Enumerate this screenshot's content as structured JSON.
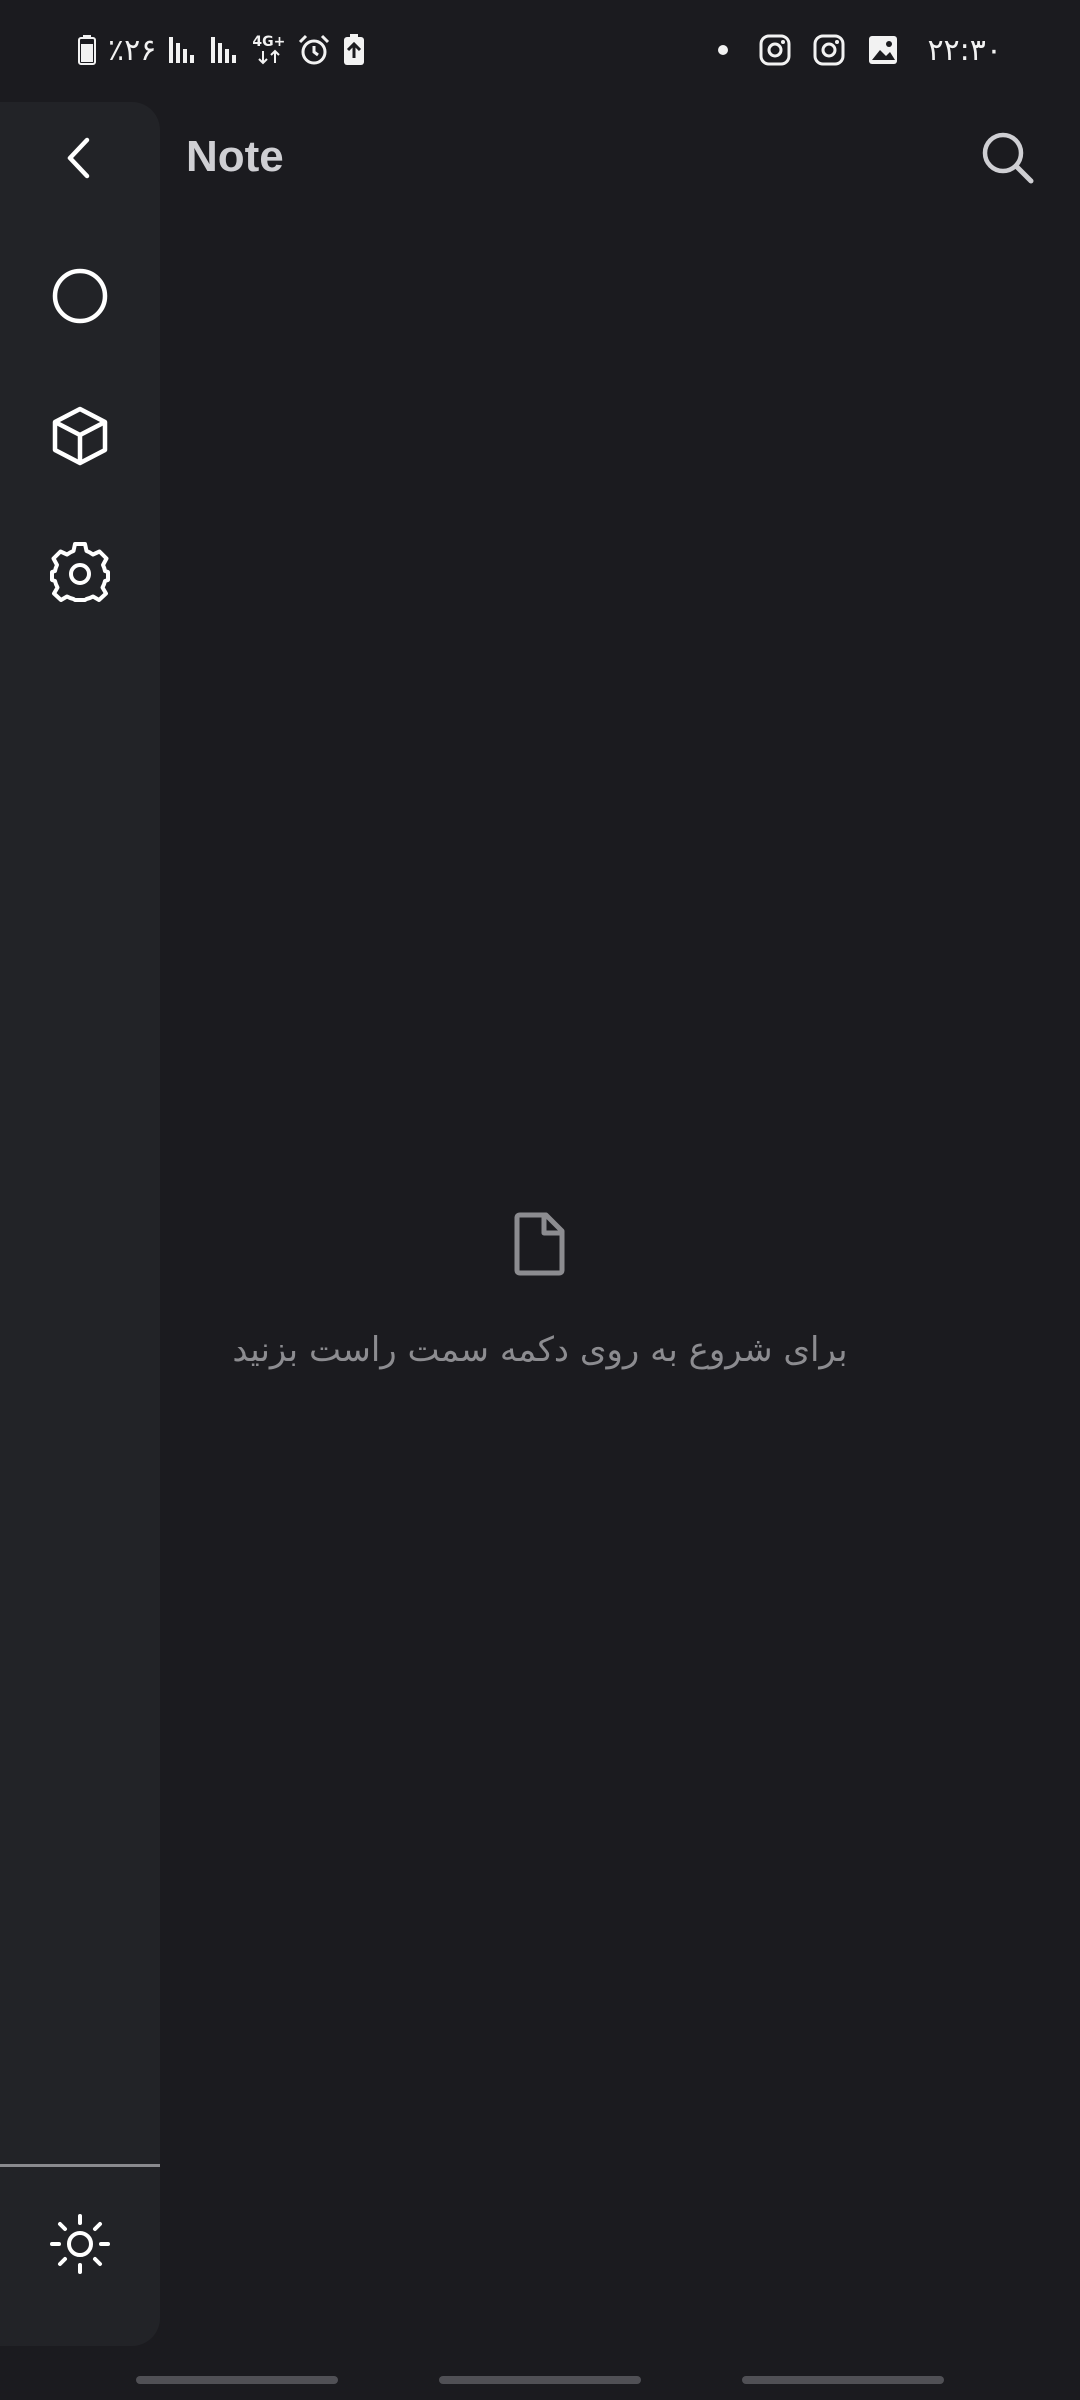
{
  "status_bar": {
    "battery_percent": "٪۲۶",
    "network_type": "4G+",
    "time": "۲۲:۳۰"
  },
  "header": {
    "title": "Note"
  },
  "rail": {
    "items": [
      {
        "icon": "chevron-left-icon"
      },
      {
        "icon": "circle-icon"
      },
      {
        "icon": "cube-icon"
      },
      {
        "icon": "gear-icon"
      }
    ],
    "bottom": {
      "icon": "sun-icon"
    }
  },
  "empty_state": {
    "icon": "file-icon",
    "message": "برای شروع به روی دکمه سمت راست بزنید"
  },
  "colors": {
    "background": "#1b1b1f",
    "rail": "#222327",
    "title": "#cfcfd3",
    "muted_text": "#8c8c90"
  }
}
